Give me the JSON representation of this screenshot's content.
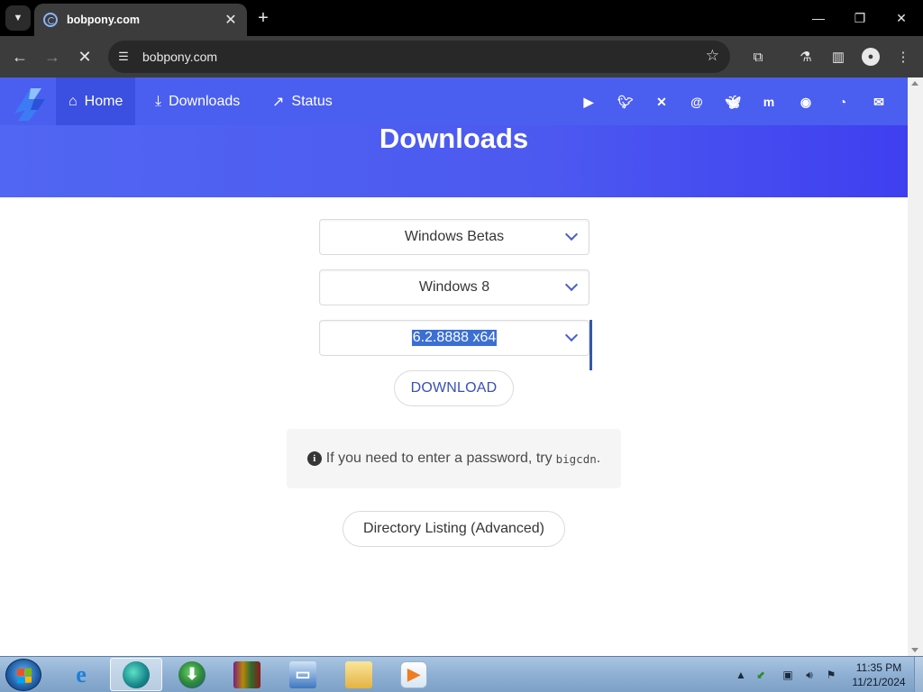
{
  "browser": {
    "tab_title": "bobpony.com",
    "url": "bobpony.com",
    "icons": {
      "tab_menu": "chevron-down-icon",
      "tab_close": "close-icon",
      "new_tab": "plus-icon",
      "minimize": "minimize-icon",
      "restore": "restore-icon",
      "close_window": "close-icon",
      "back": "arrow-left-icon",
      "forward": "arrow-right-icon",
      "stop": "stop-loading-icon",
      "site_info": "tune-icon",
      "bookmark": "star-icon",
      "extensions": "puzzle-icon",
      "labs": "flask-icon",
      "side_panel": "side-panel-icon",
      "profile": "profile-icon",
      "menu": "more-vert-icon"
    }
  },
  "site": {
    "nav": {
      "items": [
        {
          "label": "Home",
          "icon": "home-icon"
        },
        {
          "label": "Downloads",
          "icon": "download-icon"
        },
        {
          "label": "Status",
          "icon": "chart-line-icon"
        }
      ],
      "social_icons": [
        "youtube-icon",
        "twitter-icon",
        "x-icon",
        "threads-icon",
        "bluesky-icon",
        "mastodon-icon",
        "discord-icon",
        "github-icon",
        "email-icon"
      ]
    },
    "hero_title": "Downloads",
    "selects": {
      "category": "Windows Betas",
      "os": "Windows 8",
      "build": "6.2.8888 x64"
    },
    "download_label": "DOWNLOAD",
    "notice": {
      "text": "If you need to enter a password, try",
      "code": "bigcdn",
      "suffix": "."
    },
    "directory_label": "Directory Listing (Advanced)"
  },
  "colors": {
    "brand": "#4a5ff0",
    "nav_active": "#3b4fe0",
    "link": "#3850b7",
    "selection": "#3b6fd4"
  },
  "taskbar": {
    "apps": [
      "internet-explorer-icon",
      "browser-icon",
      "download-manager-icon",
      "winrar-icon",
      "network-computer-icon",
      "file-explorer-icon",
      "media-player-icon"
    ],
    "time": "11:35 PM",
    "date": "11/21/2024"
  }
}
